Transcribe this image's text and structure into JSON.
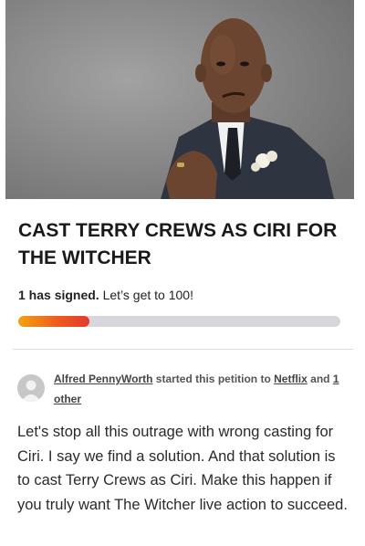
{
  "petition": {
    "title": "CAST TERRY CREWS AS CIRI FOR THE WITCHER",
    "signed_count": "1 has signed.",
    "goal_text": "Let’s get to 100!",
    "progress_fraction": 0.22,
    "starter_name": "Alfred PennyWorth",
    "started_text": "started this petition to",
    "target": "Netflix",
    "and_text": "and",
    "others_count": "1",
    "others_label": "other",
    "description": "Let's stop all this outrage with wrong casting for Ciri. I say we find a solution. And that solution is to cast Terry Crews as Ciri. Make this happen if you truly want The Witcher live action to succeed."
  },
  "colors": {
    "progress_start": "#f2a312",
    "progress_end": "#e33b2c",
    "track": "#d9d6db"
  }
}
